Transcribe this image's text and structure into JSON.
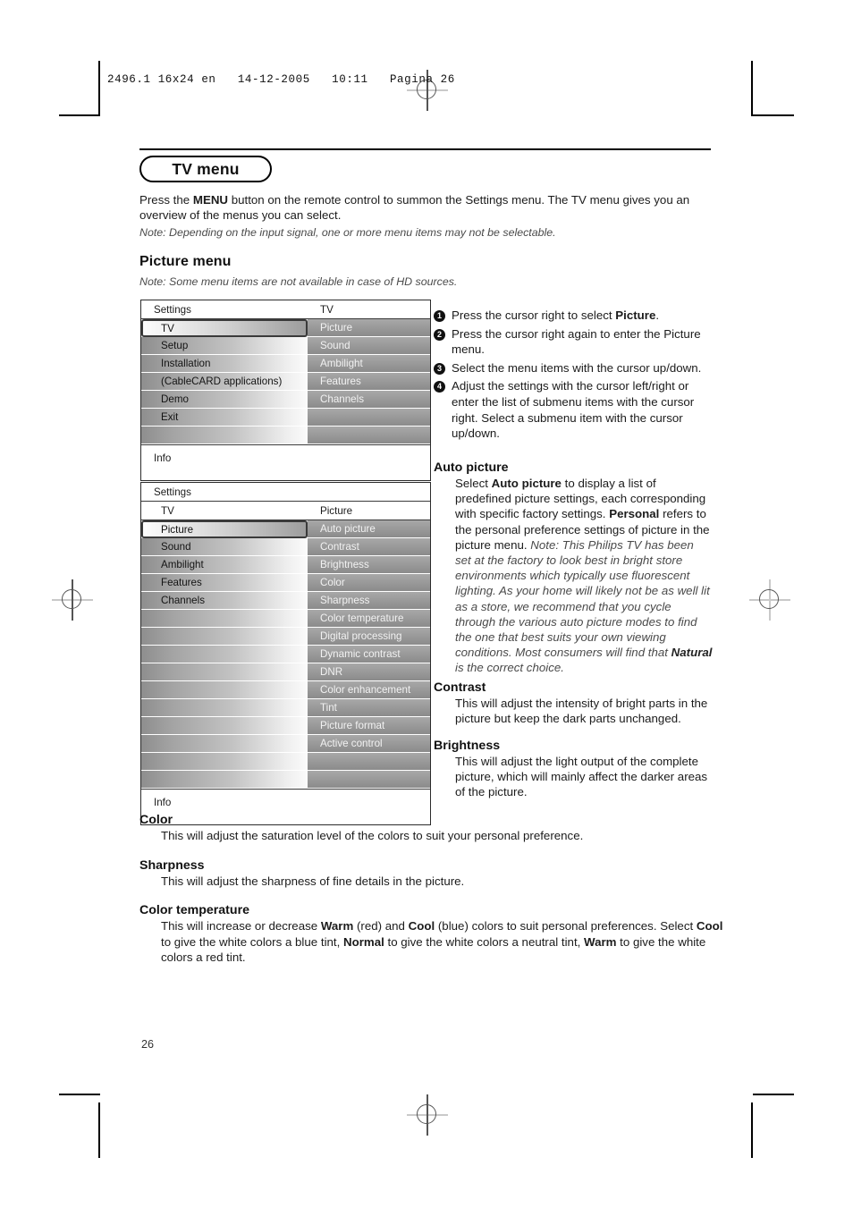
{
  "print_marks": {
    "slug": "2496.1 16x24 en   14-12-2005   10:11   Pagina 26"
  },
  "title": {
    "pill_label": "TV menu"
  },
  "intro": {
    "line1_pre": "Press the ",
    "line1_bold": "MENU",
    "line1_post": " button on the remote control to summon the Settings menu. The TV menu gives you an overview of the menus you can select.",
    "note": "Note: Depending on the input signal, one or more menu items may not be selectable."
  },
  "picture_menu_heading": {
    "heading": "Picture menu",
    "note": "Note: Some menu items are not available in case of HD sources."
  },
  "osd1": {
    "header_left": "Settings",
    "header_right": "TV",
    "left_items": [
      {
        "label": "TV",
        "selected": true
      },
      {
        "label": "Setup",
        "selected": false
      },
      {
        "label": "Installation",
        "selected": false
      },
      {
        "label": "(CableCARD applications)",
        "selected": false
      },
      {
        "label": "Demo",
        "selected": false
      },
      {
        "label": "Exit",
        "selected": false
      },
      {
        "label": "",
        "selected": false
      }
    ],
    "right_items": [
      "Picture",
      "Sound",
      "Ambilight",
      "Features",
      "Channels",
      "",
      ""
    ],
    "info_label": "Info"
  },
  "osd2": {
    "header_left": "Settings",
    "header_right": "",
    "sub_left": "TV",
    "sub_right": "Picture",
    "left_items": [
      {
        "label": "Picture",
        "selected": true
      },
      {
        "label": "Sound",
        "selected": false
      },
      {
        "label": "Ambilight",
        "selected": false
      },
      {
        "label": "Features",
        "selected": false
      },
      {
        "label": "Channels",
        "selected": false
      },
      {
        "label": "",
        "selected": false
      },
      {
        "label": "",
        "selected": false
      },
      {
        "label": "",
        "selected": false
      },
      {
        "label": "",
        "selected": false
      },
      {
        "label": "",
        "selected": false
      },
      {
        "label": "",
        "selected": false
      },
      {
        "label": "",
        "selected": false
      },
      {
        "label": "",
        "selected": false
      },
      {
        "label": "",
        "selected": false
      },
      {
        "label": "",
        "selected": false
      }
    ],
    "right_items": [
      "Auto picture",
      "Contrast",
      "Brightness",
      "Color",
      "Sharpness",
      "Color temperature",
      "Digital processing",
      "Dynamic contrast",
      "DNR",
      "Color enhancement",
      "Tint",
      "Picture format",
      "Active control",
      "",
      ""
    ],
    "info_label": "Info"
  },
  "steps": [
    {
      "num": "1",
      "pre": "Press the cursor right to select ",
      "bold": "Picture",
      "post": "."
    },
    {
      "num": "2",
      "pre": "Press the cursor right again to enter the Picture menu.",
      "bold": "",
      "post": ""
    },
    {
      "num": "3",
      "pre": "Select the menu items with the cursor up/down.",
      "bold": "",
      "post": ""
    },
    {
      "num": "4",
      "pre": "Adjust the settings with the cursor left/right or enter the list of submenu items with the cursor right. Select a submenu item with the cursor up/down.",
      "bold": "",
      "post": ""
    }
  ],
  "auto_picture": {
    "heading": "Auto picture",
    "p1_pre": "Select ",
    "p1_bold": "Auto picture",
    "p1_post": " to display a list of predefined picture settings, each corresponding with specific factory settings.",
    "p2_bold": "Personal",
    "p2_post": " refers to the personal preference settings of picture in the picture menu.",
    "note_pre": "Note: This Philips TV has been set at the factory to look best in bright store environments which typically use fluorescent lighting. As your home will likely not be as well lit as a store, we recommend that you cycle through the various auto picture modes to find the one that best suits your own viewing conditions. Most consumers will find that ",
    "note_bold": "Natural",
    "note_post": " is the correct choice."
  },
  "contrast": {
    "heading": "Contrast",
    "body": "This will adjust the intensity of bright parts in the picture but keep the dark parts unchanged."
  },
  "brightness": {
    "heading": "Brightness",
    "body": "This will adjust the light output of the complete picture, which will mainly affect the darker areas of the picture."
  },
  "color": {
    "heading": "Color",
    "body": "This will adjust the saturation level of the colors to suit your personal preference."
  },
  "sharpness": {
    "heading": "Sharpness",
    "body": "This will adjust the sharpness of fine details in the picture."
  },
  "color_temperature": {
    "heading": "Color temperature",
    "p_a": "This will increase or decrease ",
    "p_b_bold": "Warm",
    "p_c": " (red) and ",
    "p_d_bold": "Cool",
    "p_e": " (blue) colors to suit personal preferences. Select ",
    "p_f_bold": "Cool",
    "p_g": " to give the white colors a blue tint, ",
    "p_h_bold": "Normal",
    "p_i": " to give the white colors a neutral tint, ",
    "p_j_bold": "Warm",
    "p_k": " to give the white colors a red tint."
  },
  "folio": "26"
}
